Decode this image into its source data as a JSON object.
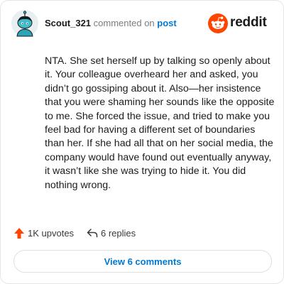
{
  "comment": {
    "username": "Scout_321",
    "verb": "commented on",
    "post_link": "post",
    "text": "NTA. She set herself up by talking so openly about it. Your colleague overheard her and asked, you didn’t go gossiping about it. Also—her insistence that you were shaming her sounds like the opposite to me. She forced the issue, and tried to make you feel bad for having a different set of boundaries than her. If she had all that on her social media, the company would have found out eventually anyway, it wasn’t like she was trying to hide it. You did nothing wrong."
  },
  "brand": {
    "wordmark": "reddit",
    "logo_icon": "reddit-logo-icon",
    "accent": "#ff4500"
  },
  "actions": {
    "upvotes_label": "1K upvotes",
    "upvote_icon": "upvote-arrow-icon",
    "upvote_color": "#ff4500",
    "replies_label": "6 replies",
    "reply_icon": "reply-arrow-icon"
  },
  "footer": {
    "view_comments_label": "View 6 comments",
    "link_color": "#0079d3"
  }
}
